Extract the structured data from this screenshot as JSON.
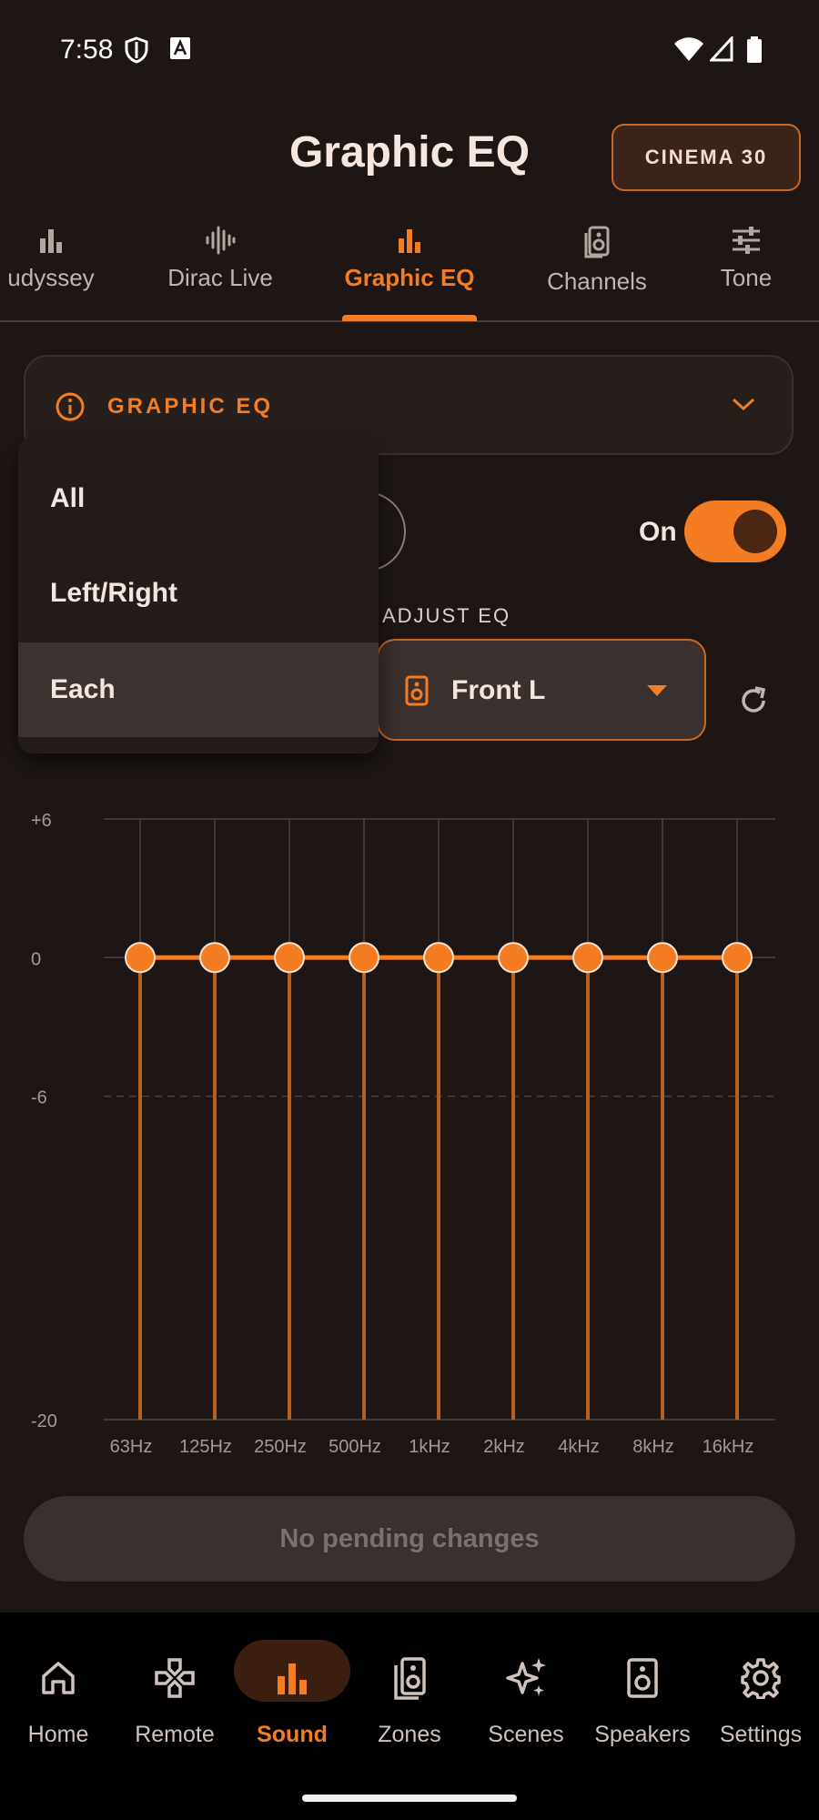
{
  "status_bar": {
    "time": "7:58"
  },
  "header": {
    "title": "Graphic EQ",
    "preset_label": "CINEMA 30"
  },
  "tabs": [
    {
      "label": "udyssey"
    },
    {
      "label": "Dirac Live"
    },
    {
      "label": "Graphic EQ"
    },
    {
      "label": "Channels"
    },
    {
      "label": "Tone"
    }
  ],
  "info_card": {
    "label": "GRAPHIC EQ"
  },
  "toggle": {
    "label": "On",
    "state": "on"
  },
  "adjust": {
    "label": "ADJUST EQ",
    "channel": "Front L"
  },
  "menu": {
    "items": [
      {
        "label": "All"
      },
      {
        "label": "Left/Right"
      },
      {
        "label": "Each"
      }
    ],
    "selected": "Each"
  },
  "chart_data": {
    "type": "line",
    "categories": [
      "63Hz",
      "125Hz",
      "250Hz",
      "500Hz",
      "1kHz",
      "2kHz",
      "4kHz",
      "8kHz",
      "16kHz"
    ],
    "values": [
      0,
      0,
      0,
      0,
      0,
      0,
      0,
      0,
      0
    ],
    "ytick_labels": [
      "+6",
      "0",
      "-6",
      "-20"
    ],
    "yticks": [
      6,
      0,
      -6,
      -20
    ],
    "ylim": [
      -20,
      6
    ],
    "grid": true,
    "colors": {
      "line": "#f47c22",
      "point": "#f47c22",
      "stem": "#b5601f"
    }
  },
  "pending": {
    "label": "No pending changes"
  },
  "bottom_nav": [
    {
      "label": "Home",
      "icon": "home-icon"
    },
    {
      "label": "Remote",
      "icon": "gamepad-icon"
    },
    {
      "label": "Sound",
      "icon": "bar-chart-icon"
    },
    {
      "label": "Zones",
      "icon": "speakers-icon"
    },
    {
      "label": "Scenes",
      "icon": "sparkles-icon"
    },
    {
      "label": "Speakers",
      "icon": "speaker-icon"
    },
    {
      "label": "Settings",
      "icon": "gear-icon"
    }
  ],
  "colors": {
    "accent": "#f47c22",
    "background": "#1d1614"
  }
}
